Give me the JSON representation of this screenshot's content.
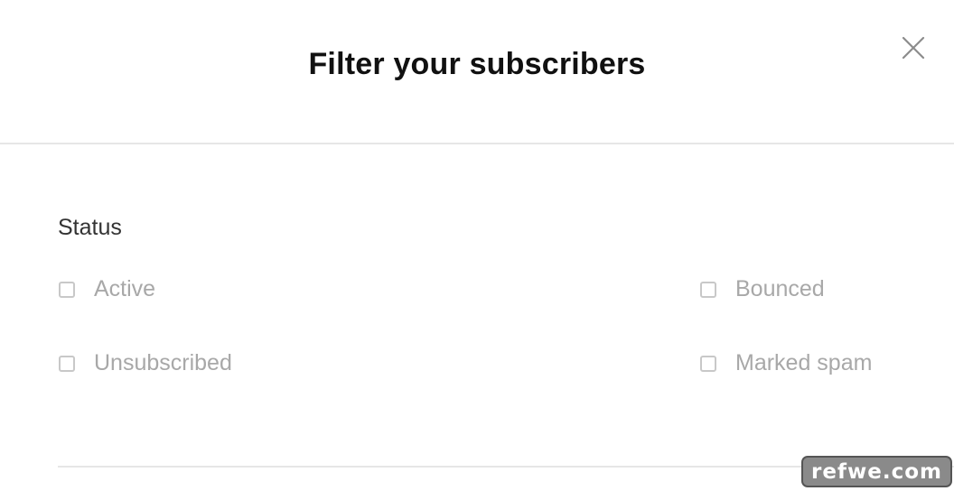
{
  "modal": {
    "title": "Filter your subscribers",
    "close_icon": "close-icon"
  },
  "status_section": {
    "title": "Status",
    "options": [
      {
        "label": "Active",
        "checked": false
      },
      {
        "label": "Bounced",
        "checked": false
      },
      {
        "label": "Unsubscribed",
        "checked": false
      },
      {
        "label": "Marked spam",
        "checked": false
      }
    ]
  },
  "watermark": {
    "text": "refwe.com"
  },
  "colors": {
    "title": "#111111",
    "section_title": "#333333",
    "option_text": "#a8a8a8",
    "checkbox_border": "#c8c8c8",
    "divider": "#e6e6e6"
  }
}
